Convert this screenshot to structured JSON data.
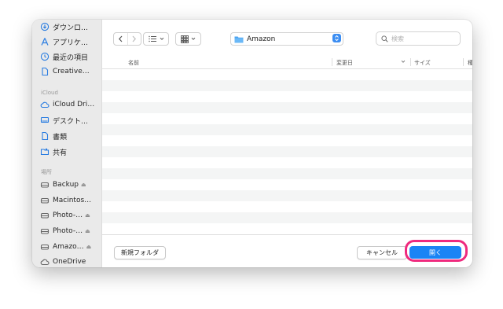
{
  "sidebar": {
    "items_top": [
      {
        "label": "ダウンロ…",
        "icon": "download-icon"
      },
      {
        "label": "アプリケ…",
        "icon": "applications-icon"
      },
      {
        "label": "最近の項目",
        "icon": "recents-clock-icon"
      },
      {
        "label": "Creative…",
        "icon": "document-icon"
      }
    ],
    "icloud_header": "iCloud",
    "icloud_items": [
      {
        "label": "iCloud Dri…",
        "icon": "cloud-icon"
      },
      {
        "label": "デスクト…",
        "icon": "desktop-icon"
      },
      {
        "label": "書類",
        "icon": "document-icon"
      },
      {
        "label": "共有",
        "icon": "shared-folder-icon"
      }
    ],
    "locations_header": "場所",
    "location_items": [
      {
        "label": "Backup",
        "icon": "drive-icon",
        "eject": "⏏"
      },
      {
        "label": "Macintos…",
        "icon": "drive-icon",
        "eject": ""
      },
      {
        "label": "Photo-…",
        "icon": "drive-icon",
        "eject": "⏏"
      },
      {
        "label": "Photo-…",
        "icon": "drive-icon",
        "eject": "⏏"
      },
      {
        "label": "Amazo…",
        "icon": "drive-icon",
        "eject": "⏏"
      },
      {
        "label": "OneDrive",
        "icon": "cloud-icon",
        "eject": ""
      }
    ]
  },
  "toolbar": {
    "current_folder": "Amazon",
    "search_placeholder": "検索"
  },
  "columns": {
    "name": "名前",
    "modified": "変更日",
    "size": "サイズ",
    "kind": "種"
  },
  "footer": {
    "new_folder": "新規フォルダ",
    "cancel": "キャンセル",
    "open": "開く"
  },
  "colors": {
    "accent": "#1a84f5",
    "highlight": "#ef2a7e"
  }
}
